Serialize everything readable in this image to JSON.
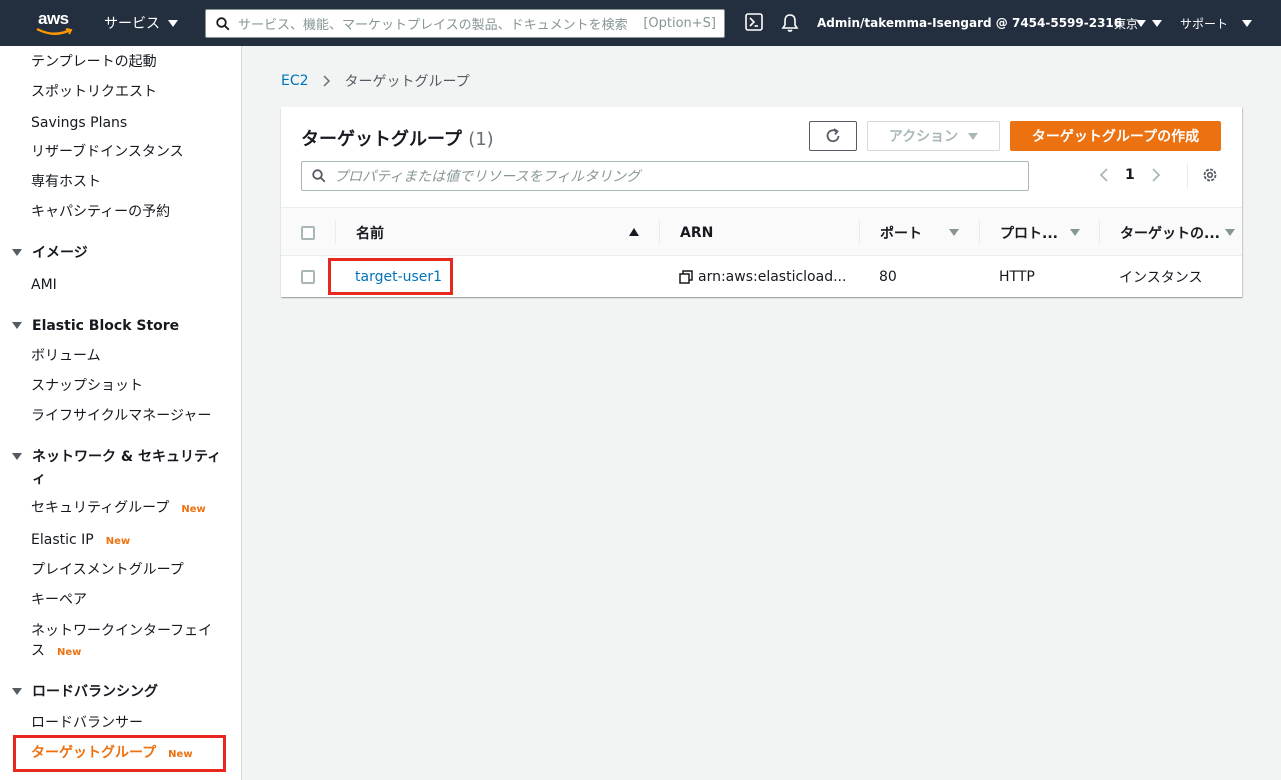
{
  "topnav": {
    "logo_text": "aws",
    "services_label": "サービス",
    "search_placeholder": "サービス、機能、マーケットプレイスの製品、ドキュメントを検索",
    "search_shortcut": "[Option+S]",
    "account_label": "Admin/takemma-Isengard @ 7454-5599-2316",
    "region_label": "東京",
    "support_label": "サポート"
  },
  "sidebar": {
    "items": {
      "launch_templates": "テンプレートの起動",
      "spot_requests": "スポットリクエスト",
      "savings_plans": "Savings Plans",
      "reserved_instances": "リザーブドインスタンス",
      "dedicated_hosts": "専有ホスト",
      "capacity_reservations": "キャパシティーの予約",
      "images_section": "イメージ",
      "ami": "AMI",
      "ebs_section": "Elastic Block Store",
      "volumes": "ボリューム",
      "snapshots": "スナップショット",
      "lifecycle_manager": "ライフサイクルマネージャー",
      "network_section_line1": "ネットワーク & セキュリティ",
      "network_section_line2": "ィ",
      "security_groups": "セキュリティグループ",
      "elastic_ip": "Elastic IP",
      "placement_groups": "プレイスメントグループ",
      "key_pairs": "キーペア",
      "network_interfaces_line1": "ネットワークインターフェイ",
      "network_interfaces_line2": "ス",
      "lb_section": "ロードバランシング",
      "load_balancers": "ロードバランサー",
      "target_groups": "ターゲットグループ"
    },
    "new_badge": "New"
  },
  "breadcrumb": {
    "root": "EC2",
    "current": "ターゲットグループ"
  },
  "panel": {
    "title": "ターゲットグループ",
    "count": "(1)",
    "actions_label": "アクション",
    "create_label": "ターゲットグループの作成",
    "filter_placeholder": "プロパティまたは値でリソースをフィルタリング",
    "page_number": "1"
  },
  "table": {
    "headers": {
      "name": "名前",
      "arn": "ARN",
      "port": "ポート",
      "protocol": "プロト...",
      "target_type": "ターゲットの..."
    },
    "rows": [
      {
        "name": "target-user1",
        "arn": "arn:aws:elasticload...",
        "port": "80",
        "protocol": "HTTP",
        "target_type": "インスタンス"
      }
    ]
  },
  "colors": {
    "nav_bg": "#232f3e",
    "accent_orange": "#ec7211",
    "link_blue": "#0073bb",
    "highlight_red": "#e8271e"
  }
}
